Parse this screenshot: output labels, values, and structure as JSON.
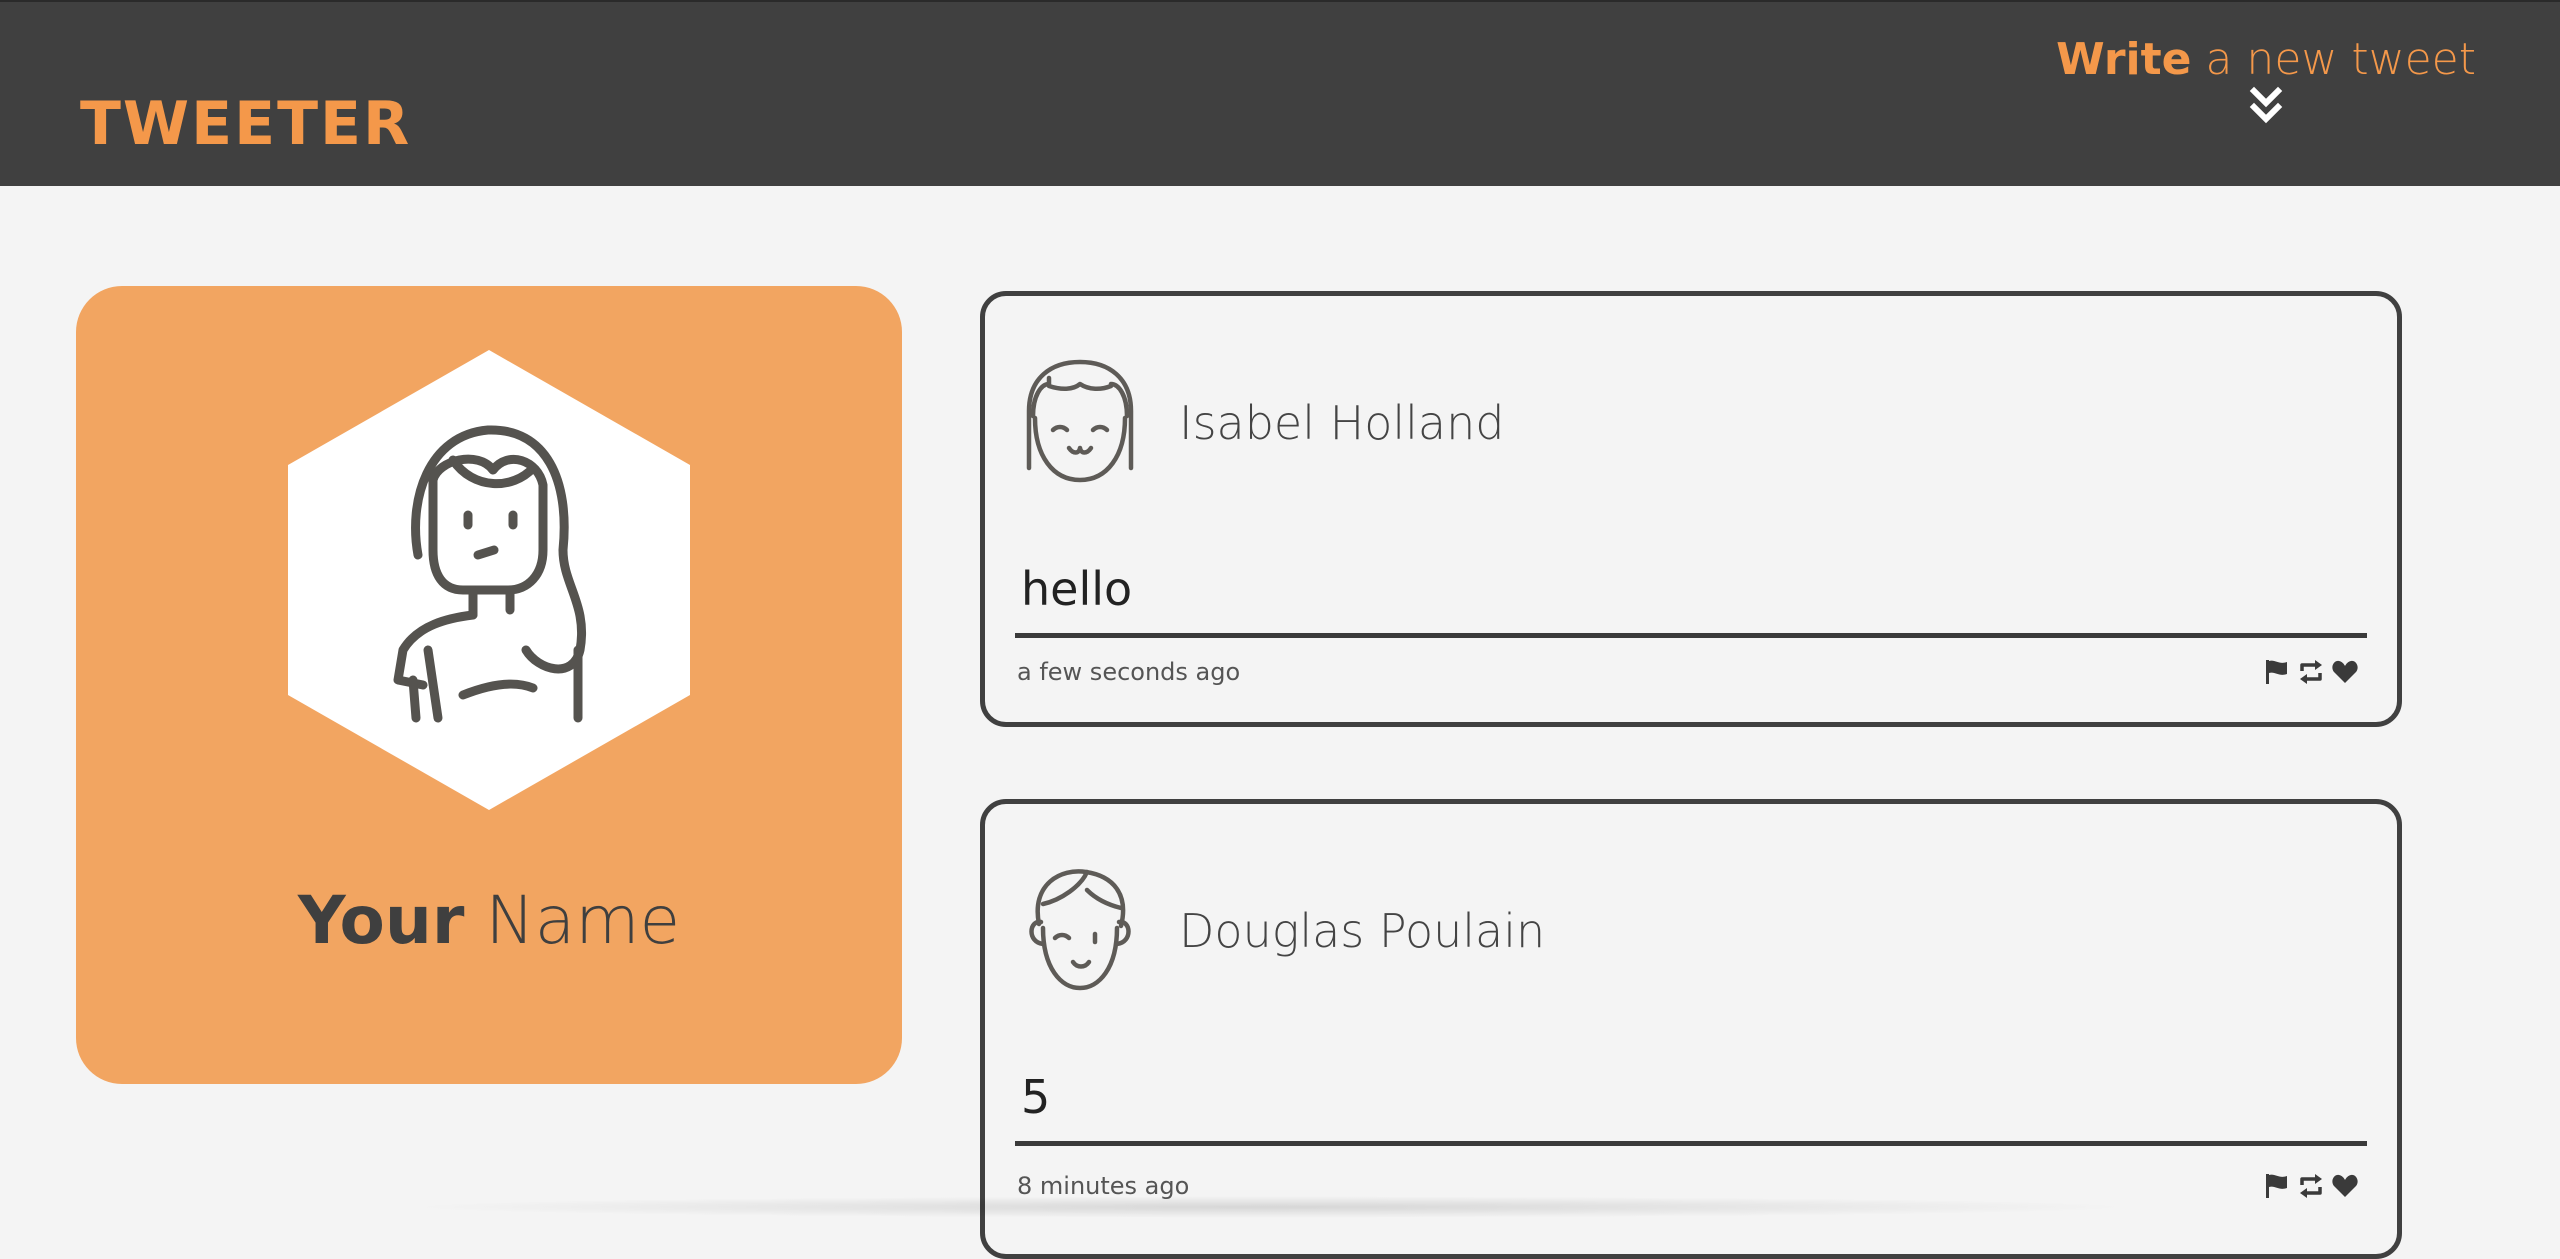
{
  "nav": {
    "brand": "TWEETER",
    "compose_strong": "Write",
    "compose_rest": " a new tweet",
    "compose_icon": "double-chevron-down-icon"
  },
  "profile": {
    "name_strong": "Your",
    "name_rest": " Name",
    "avatar_icon": "female-avatar-icon"
  },
  "tweets": [
    {
      "user": "Isabel Holland",
      "text": "hello",
      "time": "a few seconds ago",
      "avatar_icon": "girl-bangs-avatar-icon"
    },
    {
      "user": "Douglas Poulain",
      "text": "5",
      "time": "8 minutes ago",
      "avatar_icon": "boy-wink-avatar-icon"
    }
  ],
  "actions": [
    "flag-icon",
    "retweet-icon",
    "heart-icon"
  ],
  "colors": {
    "accent": "#f4984a",
    "nav_bg": "#404040",
    "card_bg": "#f2a561",
    "page_bg": "#f4f4f4"
  }
}
